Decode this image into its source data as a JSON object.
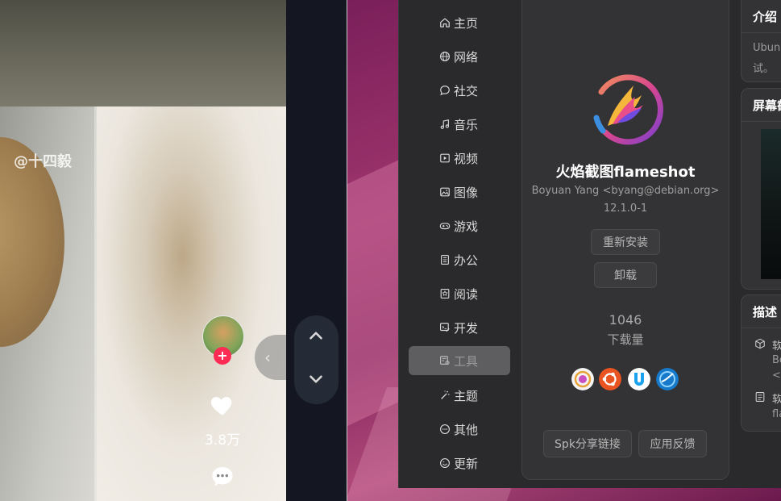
{
  "video": {
    "watermark": "@十四毅",
    "like_count": "3.8万",
    "follow_symbol": "+"
  },
  "sidebar": {
    "items": [
      {
        "label": "主页",
        "icon": "home-icon"
      },
      {
        "label": "网络",
        "icon": "globe-icon"
      },
      {
        "label": "社交",
        "icon": "chat-icon"
      },
      {
        "label": "音乐",
        "icon": "music-icon"
      },
      {
        "label": "视频",
        "icon": "video-icon"
      },
      {
        "label": "图像",
        "icon": "image-icon"
      },
      {
        "label": "游戏",
        "icon": "gamepad-icon"
      },
      {
        "label": "办公",
        "icon": "document-icon"
      },
      {
        "label": "阅读",
        "icon": "book-icon"
      },
      {
        "label": "开发",
        "icon": "code-icon"
      },
      {
        "label": "工具",
        "icon": "tools-icon",
        "active": true
      },
      {
        "label": "主题",
        "icon": "magic-wand-icon"
      },
      {
        "label": "其他",
        "icon": "more-icon"
      },
      {
        "label": "更新",
        "icon": "update-icon"
      }
    ]
  },
  "app": {
    "name": "火焰截图flameshot",
    "maintainer": "Boyuan Yang <byang@debian.org>",
    "version": "12.1.0-1",
    "reinstall_label": "重新安装",
    "uninstall_label": "卸载",
    "downloads": "1046",
    "downloads_label": "下载量",
    "distros": [
      "spark-icon",
      "ubuntu-icon",
      "uos-icon",
      "deepin-icon"
    ],
    "share_label": "Spk分享链接",
    "feedback_label": "应用反馈"
  },
  "info_cards": {
    "intro_title": "介绍",
    "intro_text_line1": "Ubun",
    "intro_text_line2": "试。",
    "screenshot_title": "屏幕截",
    "desc_title": "描述",
    "desc_row1_line1": "软",
    "desc_row1_line2": "Bo",
    "desc_row1_line3": "<b",
    "desc_row2_line1": "软",
    "desc_row2_line2": "fla"
  },
  "colors": {
    "accent": "#fe2c55",
    "ubuntu": "#e95420",
    "uos": "#1aa1f0",
    "deepin": "#1679c9"
  }
}
